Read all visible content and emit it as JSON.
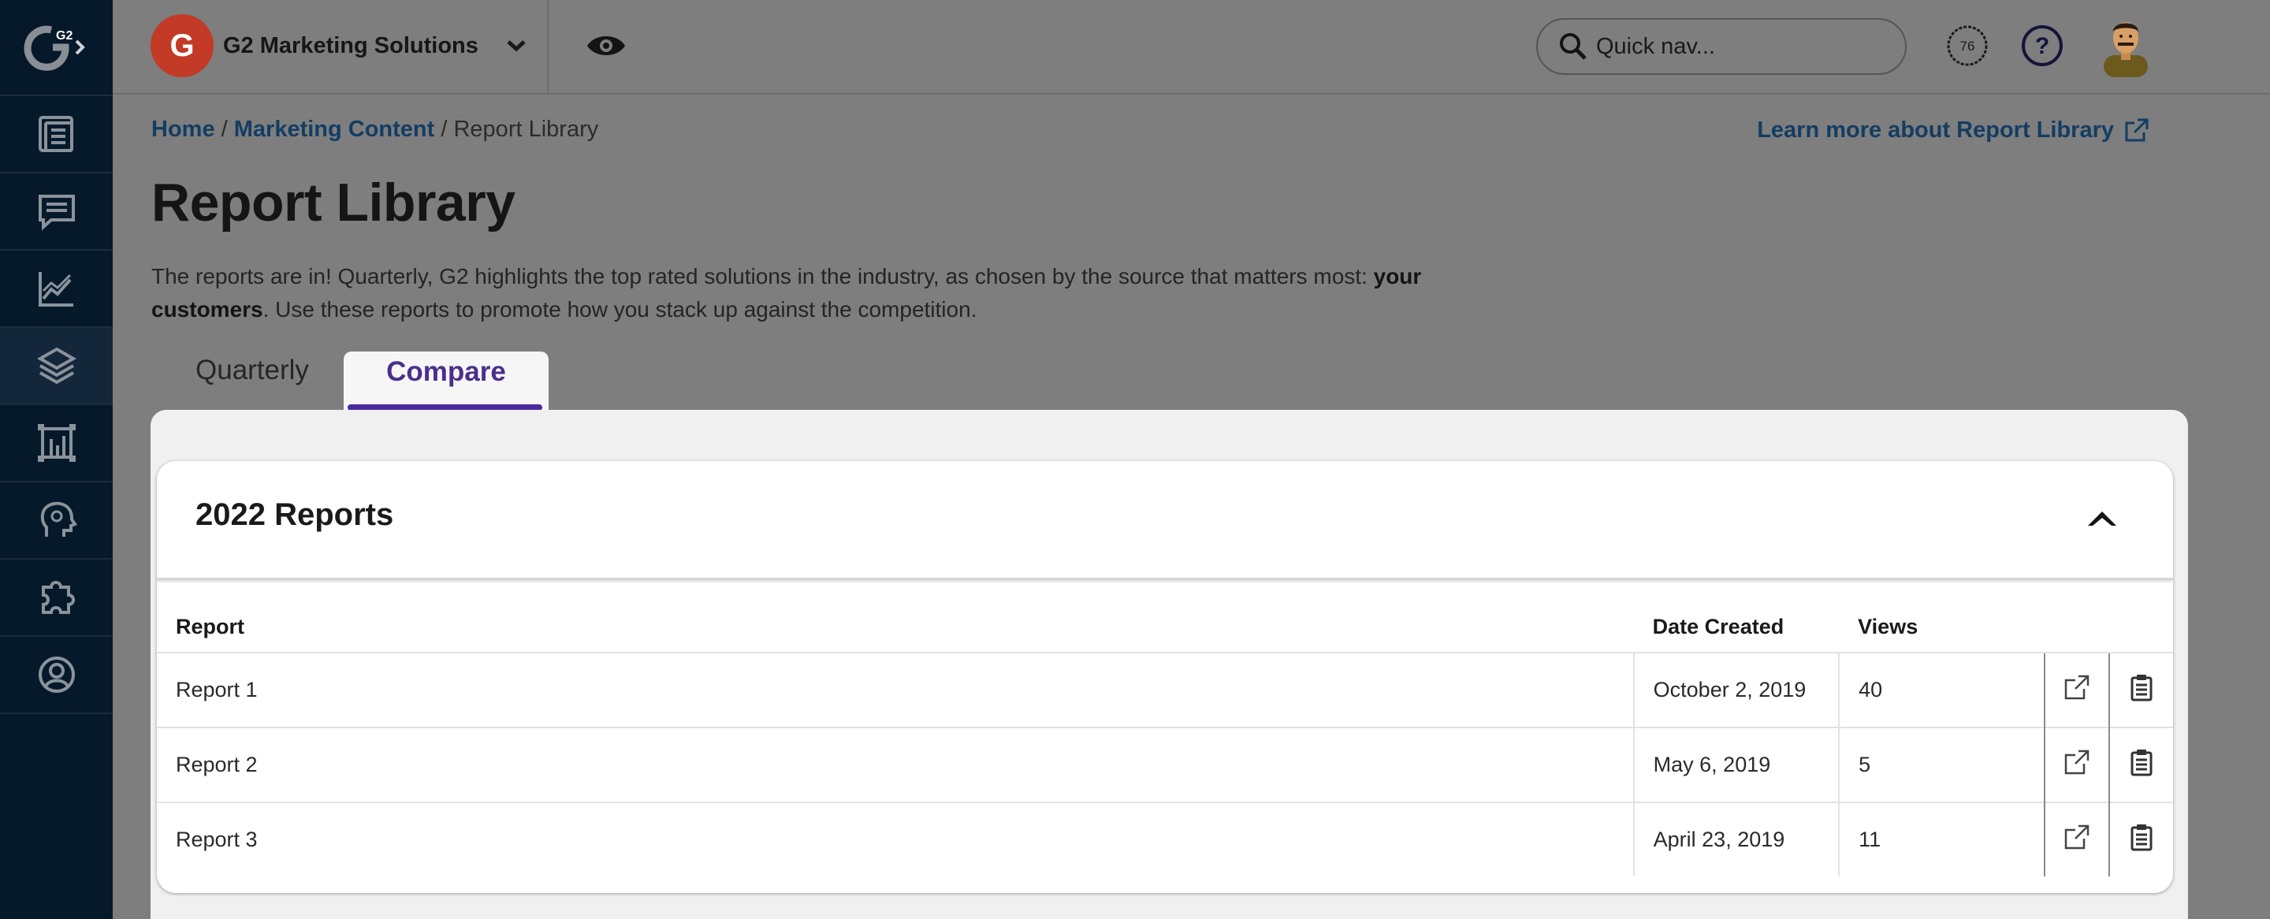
{
  "sidebar": {
    "logo": "G2",
    "items": [
      {
        "icon": "newspaper-icon"
      },
      {
        "icon": "chat-bubble-icon"
      },
      {
        "icon": "line-chart-icon"
      },
      {
        "icon": "layers-icon",
        "active": true
      },
      {
        "icon": "frame-chart-icon"
      },
      {
        "icon": "head-brain-icon"
      },
      {
        "icon": "puzzle-icon"
      },
      {
        "icon": "user-circle-icon"
      }
    ]
  },
  "topbar": {
    "company": "G2 Marketing Solutions",
    "brand_logo_text": "G",
    "search_placeholder": "Quick nav...",
    "score": "76",
    "help": "?"
  },
  "breadcrumb": {
    "home": "Home",
    "sep1": " / ",
    "marketing": "Marketing Content",
    "sep2": " / ",
    "current": "Report Library"
  },
  "learn_more": "Learn more about Report Library",
  "page_title": "Report Library",
  "description": {
    "part1": "The reports are in! Quarterly, G2 highlights the top rated solutions in the industry, as chosen by the source that matters most: ",
    "bold": "your customers",
    "part2": ". Use these reports to promote how you stack up against the competition."
  },
  "tabs": {
    "quarterly": "Quarterly",
    "compare": "Compare",
    "active": "compare"
  },
  "section": {
    "title": "2022 Reports",
    "columns": {
      "report": "Report",
      "date": "Date Created",
      "views": "Views"
    },
    "rows": [
      {
        "report": "Report 1",
        "date": "October 2, 2019",
        "views": "40"
      },
      {
        "report": "Report 2",
        "date": "May 6, 2019",
        "views": "5"
      },
      {
        "report": "Report 3",
        "date": "April 23, 2019",
        "views": "11"
      }
    ]
  },
  "colors": {
    "sidebar_bg": "#06192a",
    "overlay_bg": "#7e7e7e",
    "link": "#133d63",
    "tab_active": "#4b2a9e",
    "brand_red": "#c33a27"
  }
}
